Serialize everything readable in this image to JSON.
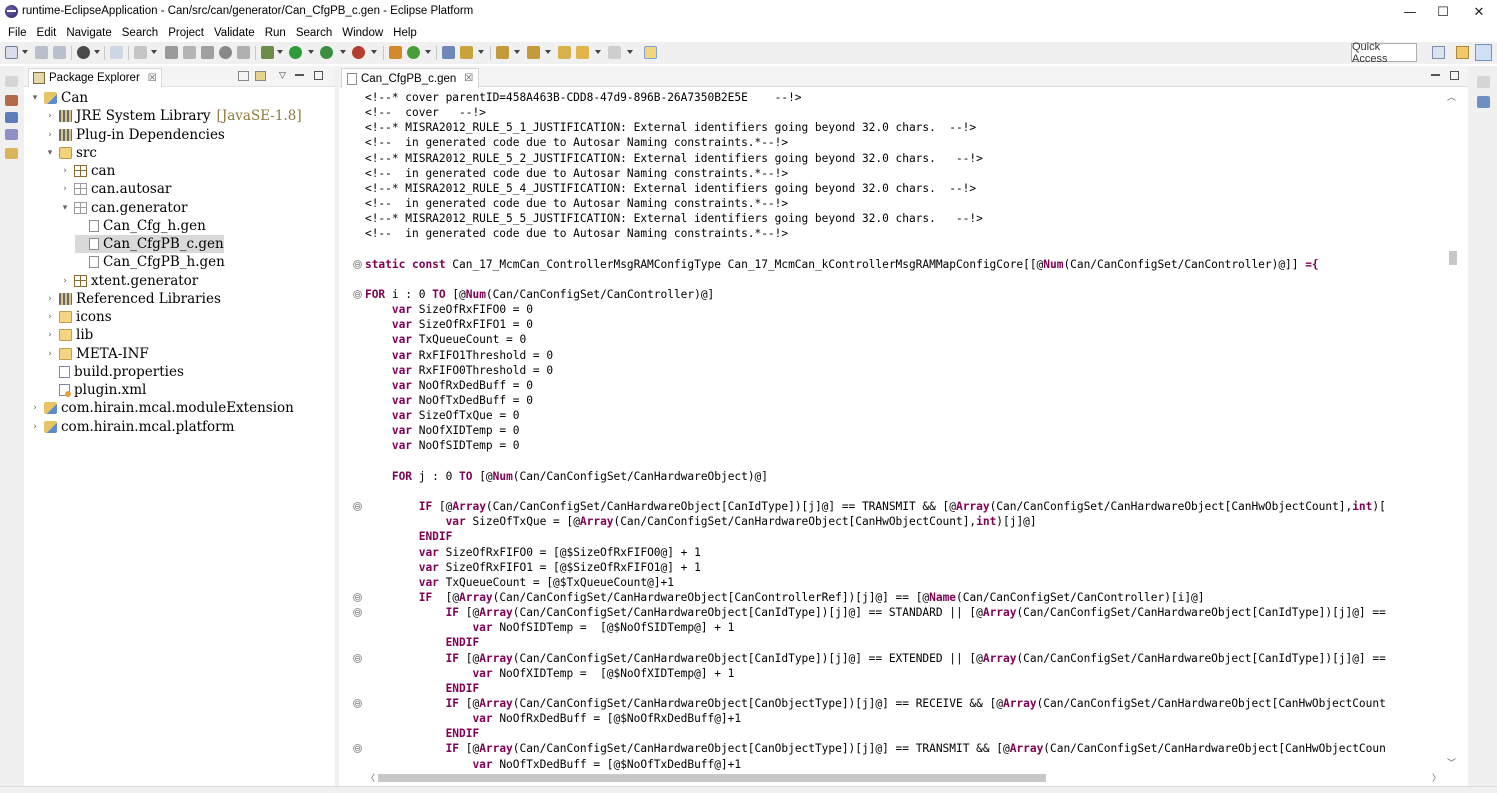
{
  "window": {
    "title": "runtime-EclipseApplication - Can/src/can/generator/Can_CfgPB_c.gen - Eclipse Platform",
    "minimize": "—",
    "maximize": "☐",
    "close": "✕"
  },
  "menu": [
    "File",
    "Edit",
    "Navigate",
    "Search",
    "Project",
    "Validate",
    "Run",
    "Search",
    "Window",
    "Help"
  ],
  "toolbar": {
    "quick_access": "Quick Access"
  },
  "package_explorer": {
    "title": "Package Explorer",
    "close_glyph": "☒",
    "tree": [
      {
        "label": "Can",
        "icon": "project-icon",
        "twisty": "▾",
        "suffix": ""
      },
      {
        "label": "JRE System Library",
        "icon": "library-icon",
        "twisty": "›",
        "suffix": "[JavaSE-1.8]"
      },
      {
        "label": "Plug-in Dependencies",
        "icon": "library-icon",
        "twisty": "›",
        "suffix": ""
      },
      {
        "label": "src",
        "icon": "source-folder-icon",
        "twisty": "▾",
        "suffix": ""
      },
      {
        "label": "can",
        "icon": "package-icon",
        "twisty": "›",
        "suffix": ""
      },
      {
        "label": "can.autosar",
        "icon": "package-empty-icon",
        "twisty": "›",
        "suffix": ""
      },
      {
        "label": "can.generator",
        "icon": "package-empty-icon",
        "twisty": "▾",
        "suffix": ""
      },
      {
        "label": "Can_Cfg_h.gen",
        "icon": "file-icon",
        "twisty": "",
        "suffix": ""
      },
      {
        "label": "Can_CfgPB_c.gen",
        "icon": "file-icon",
        "twisty": "",
        "suffix": "",
        "selected": true
      },
      {
        "label": "Can_CfgPB_h.gen",
        "icon": "file-icon",
        "twisty": "",
        "suffix": ""
      },
      {
        "label": "xtent.generator",
        "icon": "package-icon",
        "twisty": "›",
        "suffix": ""
      },
      {
        "label": "Referenced Libraries",
        "icon": "library-icon",
        "twisty": "›",
        "suffix": ""
      },
      {
        "label": "icons",
        "icon": "folder-icon",
        "twisty": "›",
        "suffix": ""
      },
      {
        "label": "lib",
        "icon": "folder-icon",
        "twisty": "›",
        "suffix": ""
      },
      {
        "label": "META-INF",
        "icon": "folder-icon",
        "twisty": "›",
        "suffix": ""
      },
      {
        "label": "build.properties",
        "icon": "properties-file-icon",
        "twisty": "",
        "suffix": ""
      },
      {
        "label": "plugin.xml",
        "icon": "xml-file-icon",
        "twisty": "",
        "suffix": ""
      },
      {
        "label": "com.hirain.mcal.moduleExtension",
        "icon": "project-icon",
        "twisty": "›",
        "suffix": ""
      },
      {
        "label": "com.hirain.mcal.platform",
        "icon": "project-icon",
        "twisty": "›",
        "suffix": ""
      }
    ]
  },
  "editor": {
    "tab_label": "Can_CfgPB_c.gen",
    "close_glyph": "☒",
    "fold_glyph": "⊖",
    "keyword_color": "#7f0055",
    "lines": [
      "<!--* cover parentID=458A463B-CDD8-47d9-896B-26A7350B2E5E    --!>",
      "<!--  cover   --!>",
      "<!--* MISRA2012_RULE_5_1_JUSTIFICATION: External identifiers going beyond 32.0 chars.  --!>",
      "<!--  in generated code due to Autosar Naming constraints.*--!>",
      "<!--* MISRA2012_RULE_5_2_JUSTIFICATION: External identifiers going beyond 32.0 chars.   --!>",
      "<!--  in generated code due to Autosar Naming constraints.*--!>",
      "<!--* MISRA2012_RULE_5_4_JUSTIFICATION: External identifiers going beyond 32.0 chars.  --!>",
      "<!--  in generated code due to Autosar Naming constraints.*--!>",
      "<!--* MISRA2012_RULE_5_5_JUSTIFICATION: External identifiers going beyond 32.0 chars.   --!>",
      "<!--  in generated code due to Autosar Naming constraints.*--!>",
      "",
      "static const Can_17_McmCan_ControllerMsgRAMConfigType Can_17_McmCan_kControllerMsgRAMMapConfigCore[[@Num(Can/CanConfigSet/CanController)@]] ={",
      "",
      "FOR i : 0 TO [@Num(Can/CanConfigSet/CanController)@]",
      "    var SizeOfRxFIFO0 = 0",
      "    var SizeOfRxFIFO1 = 0",
      "    var TxQueueCount = 0",
      "    var RxFIFO1Threshold = 0",
      "    var RxFIFO0Threshold = 0",
      "    var NoOfRxDedBuff = 0",
      "    var NoOfTxDedBuff = 0",
      "    var SizeOfTxQue = 0",
      "    var NoOfXIDTemp = 0",
      "    var NoOfSIDTemp = 0",
      "",
      "    FOR j : 0 TO [@Num(Can/CanConfigSet/CanHardwareObject)@]",
      "",
      "        IF [@Array(Can/CanConfigSet/CanHardwareObject[CanIdType])[j]@] == TRANSMIT && [@Array(Can/CanConfigSet/CanHardwareObject[CanHwObjectCount],int)[",
      "            var SizeOfTxQue = [@Array(Can/CanConfigSet/CanHardwareObject[CanHwObjectCount],int)[j]@]",
      "        ENDIF",
      "        var SizeOfRxFIFO0 = [@$SizeOfRxFIFO0@] + 1",
      "        var SizeOfRxFIFO1 = [@$SizeOfRxFIFO1@] + 1",
      "        var TxQueueCount = [@$TxQueueCount@]+1",
      "        IF  [@Array(Can/CanConfigSet/CanHardwareObject[CanControllerRef])[j]@] == [@Name(Can/CanConfigSet/CanController)[i]@]",
      "            IF [@Array(Can/CanConfigSet/CanHardwareObject[CanIdType])[j]@] == STANDARD || [@Array(Can/CanConfigSet/CanHardwareObject[CanIdType])[j]@] ==",
      "                var NoOfSIDTemp =  [@$NoOfSIDTemp@] + 1",
      "            ENDIF",
      "            IF [@Array(Can/CanConfigSet/CanHardwareObject[CanIdType])[j]@] == EXTENDED || [@Array(Can/CanConfigSet/CanHardwareObject[CanIdType])[j]@] ==",
      "                var NoOfXIDTemp =  [@$NoOfXIDTemp@] + 1",
      "            ENDIF",
      "            IF [@Array(Can/CanConfigSet/CanHardwareObject[CanObjectType])[j]@] == RECEIVE && [@Array(Can/CanConfigSet/CanHardwareObject[CanHwObjectCount",
      "                var NoOfRxDedBuff = [@$NoOfRxDedBuff@]+1",
      "            ENDIF",
      "            IF [@Array(Can/CanConfigSet/CanHardwareObject[CanObjectType])[j]@] == TRANSMIT && [@Array(Can/CanConfigSet/CanHardwareObject[CanHwObjectCoun",
      "                var NoOfTxDedBuff = [@$NoOfTxDedBuff@]+1"
    ]
  }
}
